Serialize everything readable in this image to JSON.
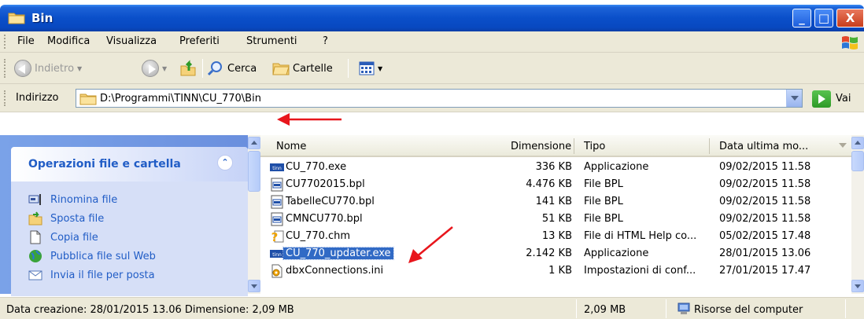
{
  "window": {
    "title": "Bin",
    "controls": {
      "minimize": "_",
      "maximize": "□",
      "close": "X"
    }
  },
  "menu": [
    "File",
    "Modifica",
    "Visualizza",
    "Preferiti",
    "Strumenti",
    "?"
  ],
  "toolbar": {
    "back_label": "Indietro",
    "search_label": "Cerca",
    "folders_label": "Cartelle"
  },
  "address": {
    "label": "Indirizzo",
    "path": "D:\\Programmi\\TINN\\CU_770\\Bin",
    "go_label": "Vai"
  },
  "task_pane": {
    "title": "Operazioni file e cartella",
    "items": [
      {
        "label": "Rinomina file",
        "icon": "rename-icon"
      },
      {
        "label": "Sposta file",
        "icon": "move-icon"
      },
      {
        "label": "Copia file",
        "icon": "copy-icon"
      },
      {
        "label": "Pubblica file sul Web",
        "icon": "publish-web-icon"
      },
      {
        "label": "Invia il file per posta",
        "icon": "mail-icon"
      }
    ]
  },
  "file_list": {
    "columns": [
      "Nome",
      "Dimensione",
      "Tipo",
      "Data ultima mo..."
    ],
    "rows": [
      {
        "name": "CU_770.exe",
        "size": "336 KB",
        "type": "Applicazione",
        "date": "09/02/2015 11.58",
        "icon": "tinn-exe-icon",
        "selected": false
      },
      {
        "name": "CU7702015.bpl",
        "size": "4.476 KB",
        "type": "File BPL",
        "date": "09/02/2015 11.58",
        "icon": "bpl-file-icon",
        "selected": false
      },
      {
        "name": "TabelleCU770.bpl",
        "size": "141 KB",
        "type": "File BPL",
        "date": "09/02/2015 11.58",
        "icon": "bpl-file-icon",
        "selected": false
      },
      {
        "name": "CMNCU770.bpl",
        "size": "51 KB",
        "type": "File BPL",
        "date": "09/02/2015 11.58",
        "icon": "bpl-file-icon",
        "selected": false
      },
      {
        "name": "CU_770.chm",
        "size": "13 KB",
        "type": "File di HTML Help co...",
        "date": "05/02/2015 17.48",
        "icon": "chm-help-icon",
        "selected": false
      },
      {
        "name": "CU_770_updater.exe",
        "size": "2.142 KB",
        "type": "Applicazione",
        "date": "28/01/2015 13.06",
        "icon": "tinn-exe-icon",
        "selected": true
      },
      {
        "name": "dbxConnections.ini",
        "size": "1 KB",
        "type": "Impostazioni di conf...",
        "date": "27/01/2015 17.47",
        "icon": "ini-file-icon",
        "selected": false
      }
    ]
  },
  "status": {
    "details": "Data creazione: 28/01/2015 13.06 Dimensione: 2,09 MB",
    "size": "2,09 MB",
    "location": "Risorse del computer"
  },
  "colors": {
    "titlebar": "#0a4fc9",
    "selection": "#316ac5",
    "task_link": "#215dc6",
    "annotation_arrow": "#e8161c"
  }
}
